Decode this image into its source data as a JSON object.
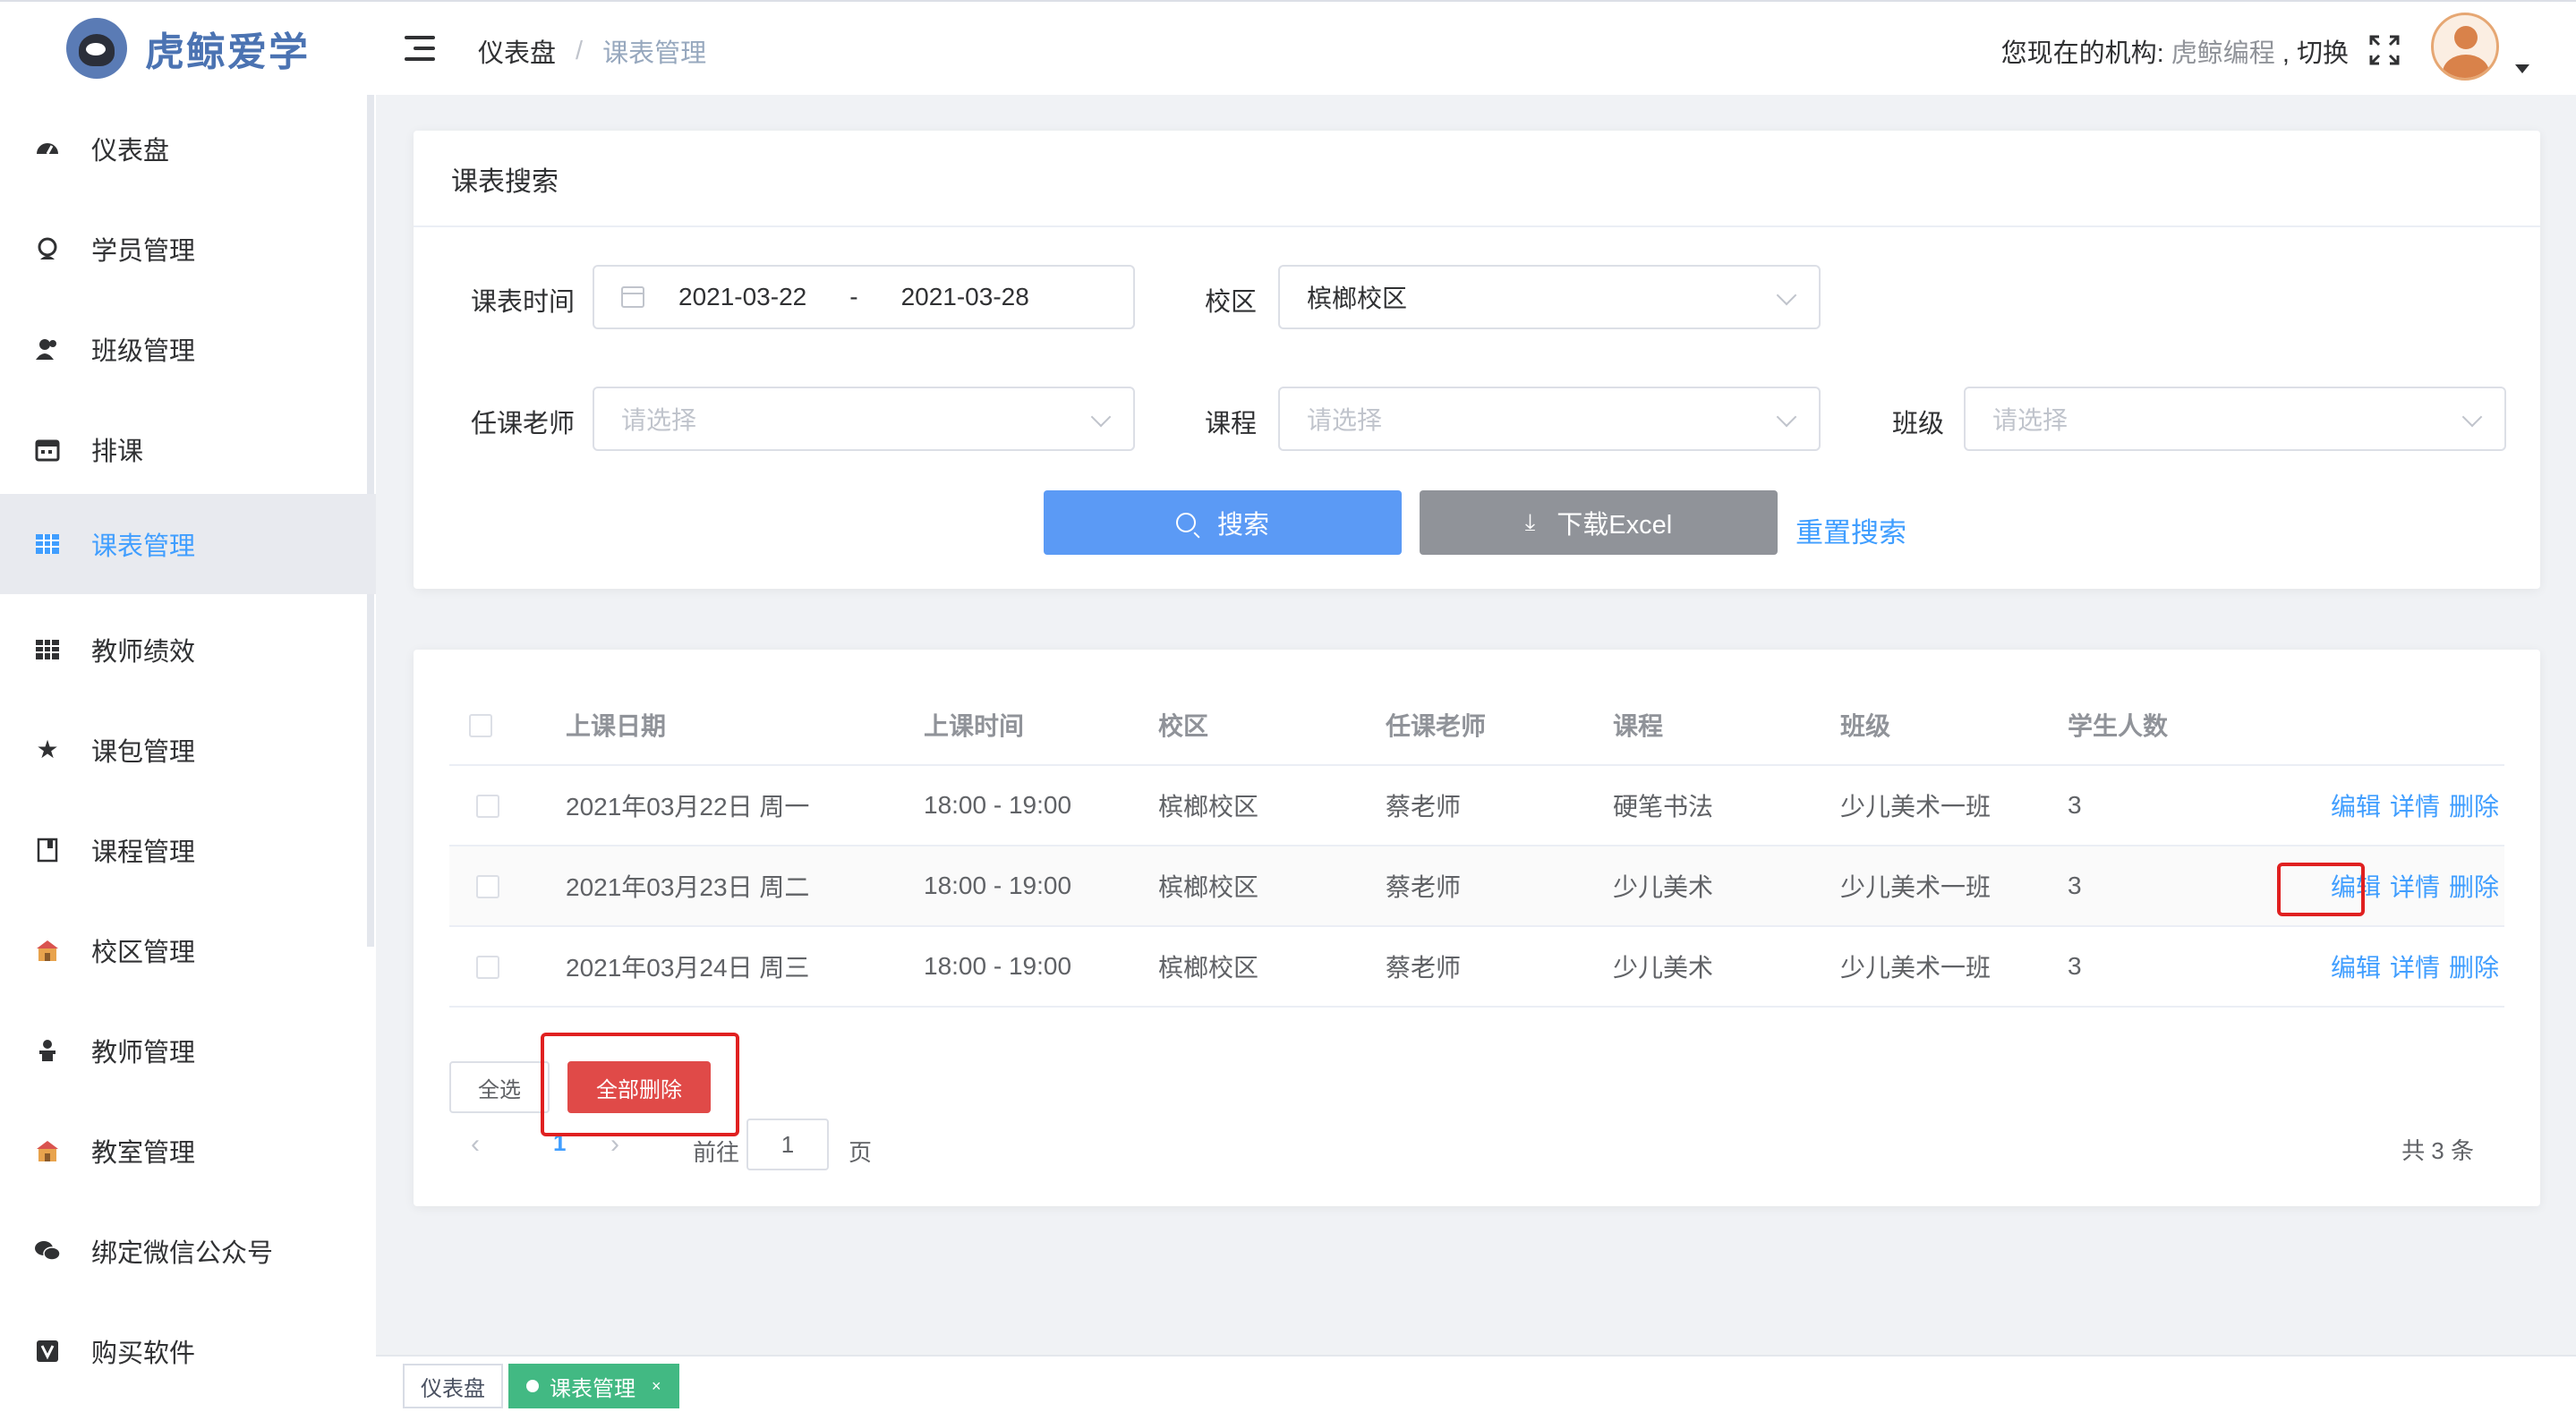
{
  "app": {
    "name": "虎鲸爱学"
  },
  "header": {
    "breadcrumb": [
      "仪表盘",
      "课表管理"
    ],
    "breadcrumb_sep": "/",
    "org_label": "您现在的机构:",
    "org_name": "虎鲸编程",
    "org_switch": ", 切换"
  },
  "sidebar": {
    "items": [
      {
        "label": "仪表盘",
        "icon": "dashboard-icon"
      },
      {
        "label": "学员管理",
        "icon": "student-icon"
      },
      {
        "label": "班级管理",
        "icon": "class-group-icon"
      },
      {
        "label": "排课",
        "icon": "calendar-icon"
      },
      {
        "label": "课表管理",
        "icon": "table-icon",
        "active": true
      },
      {
        "label": "教师绩效",
        "icon": "grid-icon"
      },
      {
        "label": "课包管理",
        "icon": "star-icon"
      },
      {
        "label": "课程管理",
        "icon": "book-icon"
      },
      {
        "label": "校区管理",
        "icon": "school-icon"
      },
      {
        "label": "教师管理",
        "icon": "teacher-icon"
      },
      {
        "label": "教室管理",
        "icon": "classroom-icon"
      },
      {
        "label": "绑定微信公众号",
        "icon": "wechat-icon"
      },
      {
        "label": "购买软件",
        "icon": "purchase-icon"
      }
    ]
  },
  "search": {
    "title": "课表搜索",
    "date_label": "课表时间",
    "date_start": "2021-03-22",
    "date_sep": "-",
    "date_end": "2021-03-28",
    "campus_label": "校区",
    "campus_value": "槟榔校区",
    "teacher_label": "任课老师",
    "teacher_placeholder": "请选择",
    "course_label": "课程",
    "course_placeholder": "请选择",
    "class_label": "班级",
    "class_placeholder": "请选择",
    "search_button": "搜索",
    "excel_button": "下载Excel",
    "reset_link": "重置搜索"
  },
  "table": {
    "columns": [
      "上课日期",
      "上课时间",
      "校区",
      "任课老师",
      "课程",
      "班级",
      "学生人数"
    ],
    "rows": [
      {
        "date": "2021年03月22日 周一",
        "time": "18:00 - 19:00",
        "campus": "槟榔校区",
        "teacher": "蔡老师",
        "course": "硬笔书法",
        "class": "少儿美术一班",
        "count": "3"
      },
      {
        "date": "2021年03月23日 周二",
        "time": "18:00 - 19:00",
        "campus": "槟榔校区",
        "teacher": "蔡老师",
        "course": "少儿美术",
        "class": "少儿美术一班",
        "count": "3"
      },
      {
        "date": "2021年03月24日 周三",
        "time": "18:00 - 19:00",
        "campus": "槟榔校区",
        "teacher": "蔡老师",
        "course": "少儿美术",
        "class": "少儿美术一班",
        "count": "3"
      }
    ],
    "actions": {
      "edit": "编辑",
      "detail": "详情",
      "delete": "删除"
    },
    "select_all": "全选",
    "delete_all": "全部删除"
  },
  "pagination": {
    "current": "1",
    "goto_label": "前往",
    "goto_value": "1",
    "page_unit": "页",
    "total": "共 3 条"
  },
  "tags": [
    {
      "label": "仪表盘"
    },
    {
      "label": "课表管理",
      "close": "×"
    }
  ],
  "colors": {
    "primary": "#409eff",
    "search_button": "#5b9af5",
    "excel_button": "#909399",
    "danger": "#e04a48",
    "highlight": "#e02020",
    "tag_active": "#42b983"
  }
}
